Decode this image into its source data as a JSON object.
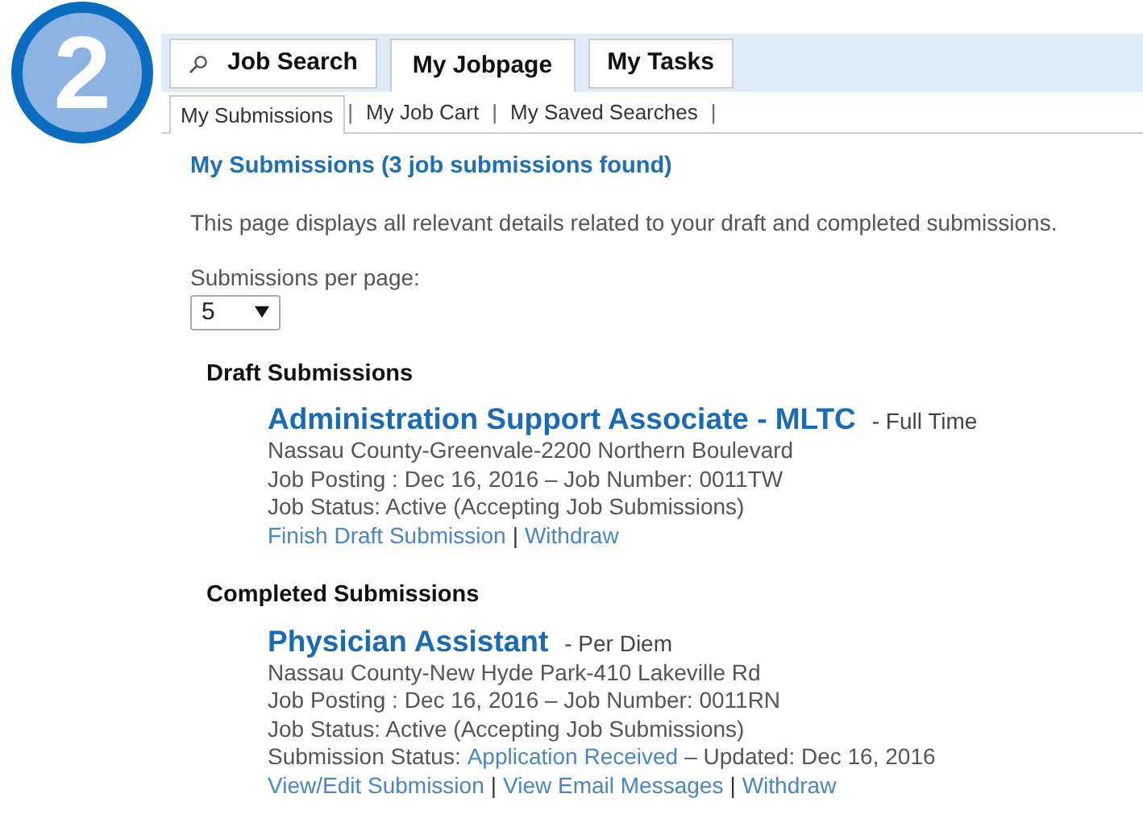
{
  "step_badge": "2",
  "tabs": [
    {
      "label": "Job Search",
      "kind": "search",
      "selected": false
    },
    {
      "label": "My Jobpage",
      "kind": "plain",
      "selected": true
    },
    {
      "label": "My Tasks",
      "kind": "plain",
      "selected": false
    }
  ],
  "subtabs": [
    {
      "label": "My Submissions",
      "selected": true,
      "separator": "|"
    },
    {
      "label": "My Job Cart",
      "selected": false,
      "separator": "|"
    },
    {
      "label": "My Saved Searches",
      "selected": false,
      "separator": "|"
    }
  ],
  "heading": "My Submissions (3 job submissions found)",
  "description": "This page displays all relevant details related to your draft and completed submissions.",
  "per_page": {
    "label": "Submissions per page:",
    "value": "5"
  },
  "sections": [
    {
      "title": "Draft Submissions",
      "jobs": [
        {
          "title": "Administration Support Associate - MLTC",
          "type": "- Full Time",
          "location": "Nassau County-Greenvale-2200 Northern Boulevard",
          "posting": "Job Posting : Dec 16, 2016 – Job Number: 0011TW",
          "status": "Job Status: Active (Accepting Job Submissions)",
          "actions": [
            {
              "label": "Finish Draft Submission",
              "separator": "|"
            },
            {
              "label": "Withdraw"
            }
          ]
        }
      ]
    },
    {
      "title": "Completed Submissions",
      "jobs": [
        {
          "title": "Physician Assistant",
          "type": "- Per Diem",
          "location": "Nassau County-New Hyde Park-410 Lakeville Rd",
          "posting": "Job Posting : Dec 16, 2016 – Job Number: 0011RN",
          "status": "Job Status: Active (Accepting Job Submissions)",
          "submission_status": {
            "label": "Submission Status:",
            "value": "Application Received",
            "updated": "– Updated: Dec 16, 2016"
          },
          "actions": [
            {
              "label": "View/Edit Submission",
              "separator": "|"
            },
            {
              "label": "View Email Messages",
              "separator": "|"
            },
            {
              "label": "Withdraw"
            }
          ]
        }
      ]
    }
  ]
}
